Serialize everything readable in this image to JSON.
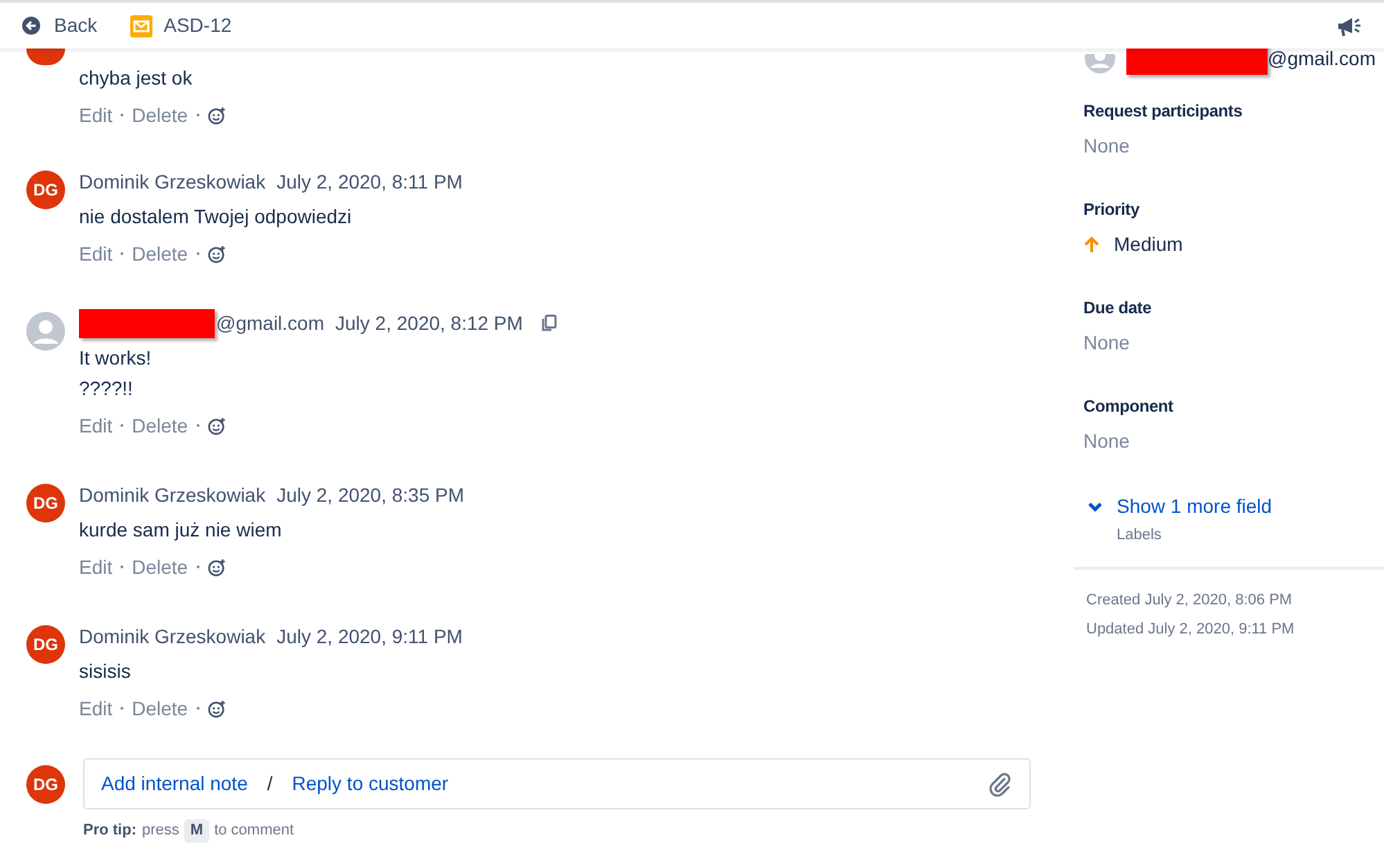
{
  "header": {
    "back": "Back",
    "issue_key": "ASD-12"
  },
  "comments": [
    {
      "kind": "partial",
      "lines": [
        "chyba jest ok"
      ],
      "actions": [
        "Edit",
        "Delete"
      ]
    },
    {
      "kind": "agent",
      "initials": "DG",
      "author": "Dominik Grzeskowiak",
      "time": "July 2, 2020, 8:11 PM",
      "lines": [
        "nie dostalem Twojej odpowiedzi"
      ],
      "actions": [
        "Edit",
        "Delete"
      ]
    },
    {
      "kind": "customer",
      "author_suffix": "@gmail.com",
      "redacted": true,
      "time": "July 2, 2020, 8:12 PM",
      "copy": true,
      "lines": [
        "It works!",
        "????!!"
      ],
      "actions": [
        "Edit",
        "Delete"
      ]
    },
    {
      "kind": "agent",
      "initials": "DG",
      "author": "Dominik Grzeskowiak",
      "time": "July 2, 2020, 8:35 PM",
      "lines": [
        "kurde sam już nie wiem"
      ],
      "actions": [
        "Edit",
        "Delete"
      ]
    },
    {
      "kind": "agent",
      "initials": "DG",
      "author": "Dominik Grzeskowiak",
      "time": "July 2, 2020, 9:11 PM",
      "lines": [
        "sisisis"
      ],
      "actions": [
        "Edit",
        "Delete"
      ]
    }
  ],
  "composer": {
    "initials": "DG",
    "internal_note": "Add internal note",
    "separator": "/",
    "reply": "Reply to customer",
    "pro_tip_label": "Pro tip:",
    "pro_tip_press": "press",
    "pro_tip_key": "M",
    "pro_tip_rest": "to comment"
  },
  "sidebar": {
    "reporter_suffix": "@gmail.com",
    "fields": [
      {
        "label": "Request participants",
        "value": "None",
        "kind": "empty"
      },
      {
        "label": "Priority",
        "value": "Medium",
        "kind": "priority"
      },
      {
        "label": "Due date",
        "value": "None",
        "kind": "empty"
      },
      {
        "label": "Component",
        "value": "None",
        "kind": "empty"
      }
    ],
    "show_more": "Show 1 more field",
    "show_more_hint": "Labels",
    "created": "Created July 2, 2020, 8:06 PM",
    "updated": "Updated July 2, 2020, 9:11 PM"
  }
}
